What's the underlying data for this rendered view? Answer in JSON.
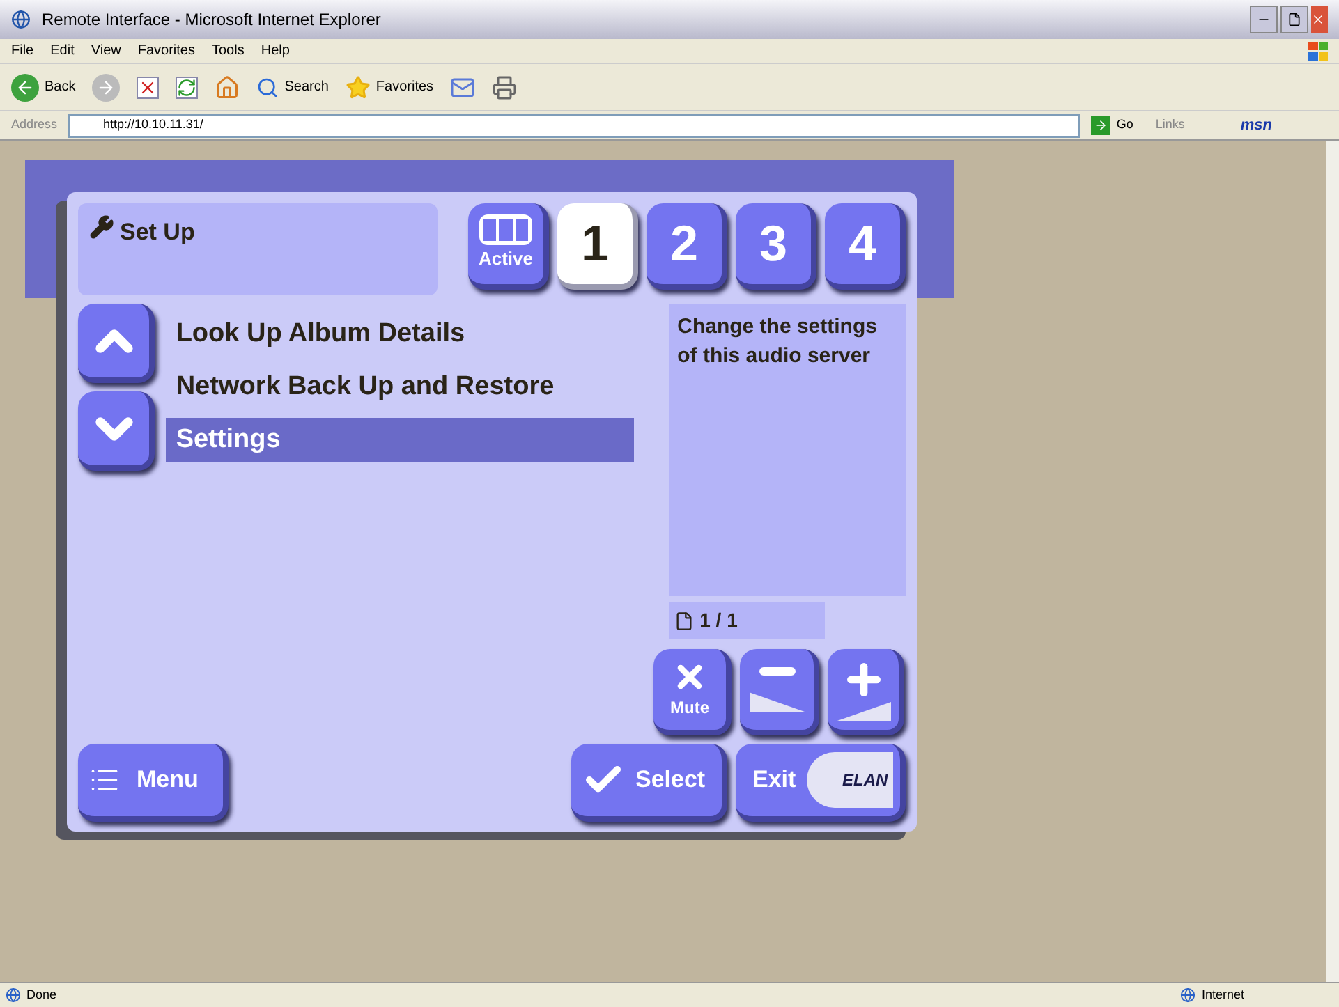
{
  "window": {
    "title": "Remote Interface - Microsoft Internet Explorer"
  },
  "menu_bar": [
    "File",
    "Edit",
    "View",
    "Favorites",
    "Tools",
    "Help"
  ],
  "toolbar": {
    "back": "Back",
    "search": "Search",
    "favorites": "Favorites"
  },
  "address_bar": {
    "label": "Address",
    "value": "http://10.10.11.31/",
    "go": "Go",
    "links": "Links",
    "msn": "msn"
  },
  "remote": {
    "title": "Set Up",
    "tabs": [
      {
        "kind": "active",
        "label": "Active",
        "selected": false
      },
      {
        "kind": "zone",
        "label": "1",
        "selected": true
      },
      {
        "kind": "zone",
        "label": "2",
        "selected": false
      },
      {
        "kind": "zone",
        "label": "3",
        "selected": false
      },
      {
        "kind": "zone",
        "label": "4",
        "selected": false
      }
    ],
    "items": [
      {
        "label": "Look Up Album Details",
        "selected": false
      },
      {
        "label": "Network Back Up and Restore",
        "selected": false
      },
      {
        "label": "Settings",
        "selected": true
      }
    ],
    "description": "Change the settings of this audio server",
    "page": "1 / 1",
    "mute": "Mute",
    "menu_button": "Menu",
    "select_button": "Select",
    "exit_button": "Exit",
    "logo": "ELAN"
  },
  "status_bar": {
    "status": "Done",
    "zone": "Internet"
  }
}
